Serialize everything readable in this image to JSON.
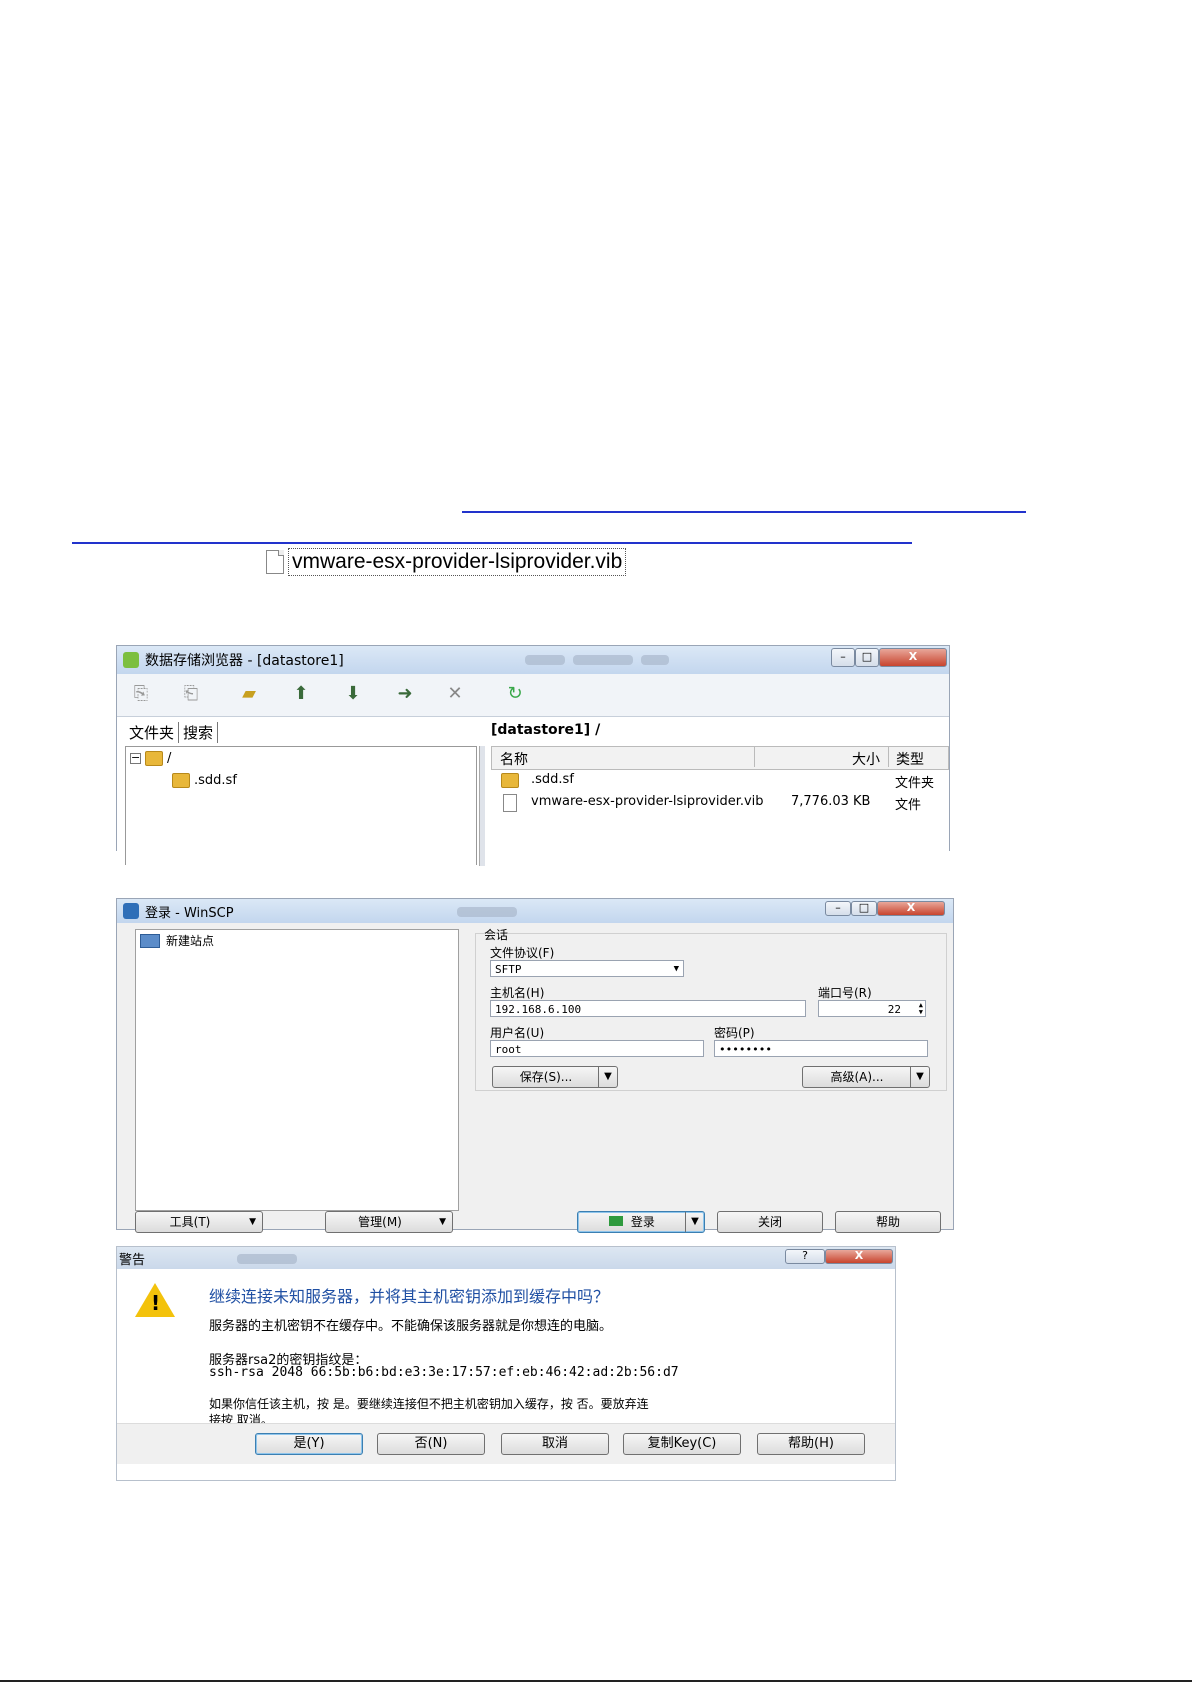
{
  "file_chip": {
    "name": "vmware-esx-provider-lsiprovider.vib",
    "icon": "document-icon"
  },
  "datastore_browser": {
    "title": "数据存储浏览器 - [datastore1]",
    "tabs": [
      "文件夹",
      "搜索"
    ],
    "tree": [
      {
        "label": "/",
        "icon": "folder-icon"
      },
      {
        "label": ".sdd.sf",
        "icon": "folder-icon"
      }
    ],
    "path": "[datastore1] /",
    "columns": {
      "name": "名称",
      "size": "大小",
      "type": "类型"
    },
    "rows": [
      {
        "name": ".sdd.sf",
        "size": "",
        "type": "文件夹",
        "icon": "folder-icon"
      },
      {
        "name": "vmware-esx-provider-lsiprovider.vib",
        "size": "7,776.03 KB",
        "type": "文件",
        "icon": "document-icon"
      }
    ],
    "window_controls": {
      "close": "X"
    }
  },
  "winscp": {
    "title": "登录 - WinSCP",
    "site_list": {
      "new_site": "新建站点"
    },
    "session": {
      "group_label": "会话",
      "protocol_label": "文件协议(F)",
      "protocol_value": "SFTP",
      "host_label": "主机名(H)",
      "host_value": "192.168.6.100",
      "port_label": "端口号(R)",
      "port_value": "22",
      "user_label": "用户名(U)",
      "user_value": "root",
      "password_label": "密码(P)",
      "password_value": "••••••••",
      "save_button": "保存(S)...",
      "advanced_button": "高级(A)..."
    },
    "bottom": {
      "tools": "工具(T)",
      "manage": "管理(M)",
      "login": "登录",
      "close": "关闭",
      "help": "帮助"
    }
  },
  "warning": {
    "title": "警告",
    "headline": "继续连接未知服务器，并将其主机密钥添加到缓存中吗？",
    "line1": "服务器的主机密钥不在缓存中。不能确保该服务器就是你想连的电脑。",
    "line2": "服务器rsa2的密钥指纹是：",
    "line3": "ssh-rsa 2048 66:5b:b6:bd:e3:3e:17:57:ef:eb:46:42:ad:2b:56:d7",
    "line4": "如果你信任该主机，按 是。要继续连接但不把主机密钥加入缓存，按 否。要放弃连",
    "line5": "接按 取消。",
    "buttons": {
      "yes": "是(Y)",
      "no": "否(N)",
      "cancel": "取消",
      "copy_key": "复制Key(C)",
      "help": "帮助(H)"
    },
    "controls": {
      "help": "?",
      "close": "X"
    }
  }
}
